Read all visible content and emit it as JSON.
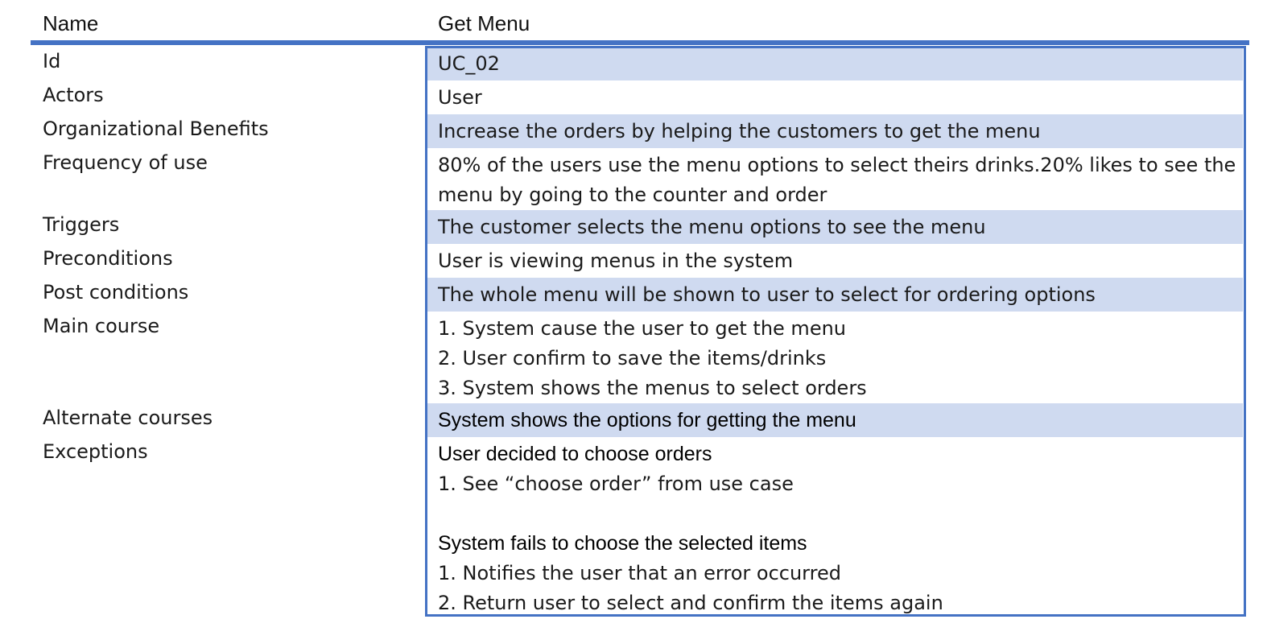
{
  "header": {
    "name_label": "Name",
    "name_value": "Get Menu"
  },
  "rows": [
    {
      "label": "Id",
      "lines": [
        "UC_02"
      ],
      "shaded": true
    },
    {
      "label": "Actors",
      "lines": [
        "User"
      ],
      "shaded": false
    },
    {
      "label": "Organizational Benefits",
      "lines": [
        "Increase the orders by helping the customers to get the menu"
      ],
      "shaded": true
    },
    {
      "label": "Frequency of use",
      "lines": [
        "80% of the users use the menu options to select theirs drinks.20% likes to see the",
        "menu by going to the counter and order"
      ],
      "shaded": false
    },
    {
      "label": "Triggers",
      "lines": [
        "The customer selects the menu options to see the menu"
      ],
      "shaded": true
    },
    {
      "label": "Preconditions",
      "lines": [
        "User is viewing menus in the system"
      ],
      "shaded": false
    },
    {
      "label": "Post conditions",
      "lines": [
        "The whole menu will be shown to user to select for ordering options"
      ],
      "shaded": true
    },
    {
      "label": "Main course",
      "lines": [
        "1. System cause the user to get the menu",
        "2. User confirm to save the items/drinks",
        "3. System shows the menus to select orders"
      ],
      "shaded": false
    },
    {
      "label": "Alternate courses",
      "lines": [
        "System shows the options for getting the menu"
      ],
      "shaded": true,
      "bold": [
        0
      ]
    },
    {
      "label": "Exceptions",
      "lines": [
        "User decided to choose orders",
        "1. See “choose order” from use case",
        "",
        "System fails to choose the selected items",
        "1. Notifies the user that an error occurred",
        "2. Return user to select and confirm the items again"
      ],
      "shaded": false,
      "bold": [
        0,
        3
      ]
    }
  ],
  "colors": {
    "accent": "#4472c4",
    "row_shade": "#cfdaf0"
  }
}
